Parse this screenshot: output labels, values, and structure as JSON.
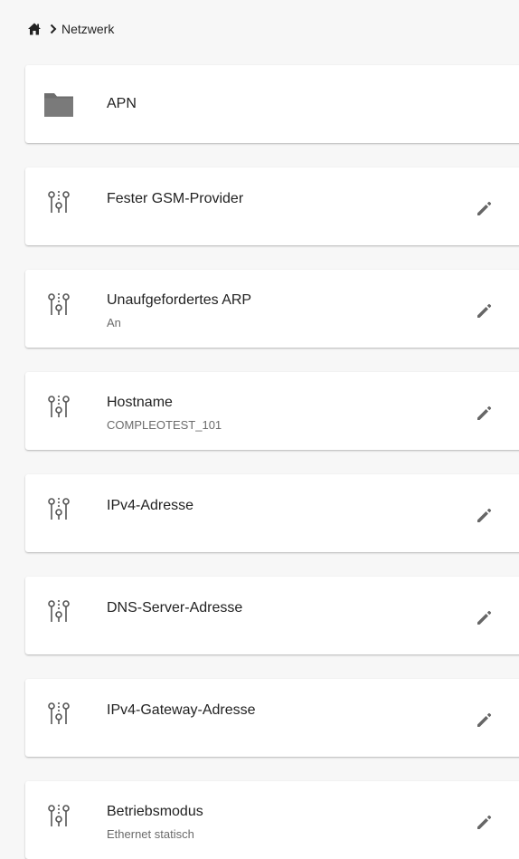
{
  "breadcrumb": {
    "home_icon": "home-icon",
    "separator_icon": "chevron-right-icon",
    "current": "Netzwerk"
  },
  "folder": {
    "icon": "folder-icon",
    "title": "APN"
  },
  "settings": [
    {
      "title": "Fester GSM-Provider",
      "value": "",
      "icon": "settings-sliders-icon",
      "action_icon": "pencil-icon"
    },
    {
      "title": "Unaufgefordertes ARP",
      "value": "An",
      "icon": "settings-sliders-icon",
      "action_icon": "pencil-icon"
    },
    {
      "title": "Hostname",
      "value": "COMPLEOTEST_101",
      "icon": "settings-sliders-icon",
      "action_icon": "pencil-icon"
    },
    {
      "title": "IPv4-Adresse",
      "value": "",
      "icon": "settings-sliders-icon",
      "action_icon": "pencil-icon"
    },
    {
      "title": "DNS-Server-Adresse",
      "value": "",
      "icon": "settings-sliders-icon",
      "action_icon": "pencil-icon"
    },
    {
      "title": "IPv4-Gateway-Adresse",
      "value": "",
      "icon": "settings-sliders-icon",
      "action_icon": "pencil-icon"
    },
    {
      "title": "Betriebsmodus",
      "value": "Ethernet statisch",
      "icon": "settings-sliders-icon",
      "action_icon": "pencil-icon"
    }
  ],
  "colors": {
    "background": "#f7f7f7",
    "card": "#ffffff",
    "text": "#222222",
    "subtext": "#6b6b6b",
    "icon": "#555555",
    "folder": "#6e6e6e"
  }
}
